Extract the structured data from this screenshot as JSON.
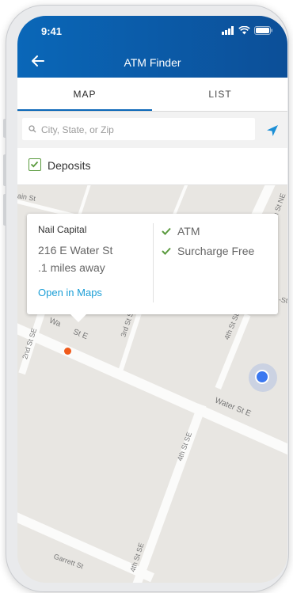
{
  "status": {
    "time": "9:41"
  },
  "header": {
    "title": "ATM Finder"
  },
  "tabs": [
    {
      "label": "MAP"
    },
    {
      "label": "LIST"
    }
  ],
  "search": {
    "placeholder": "City, State, or Zip"
  },
  "filter": {
    "label": "Deposits",
    "checked": true
  },
  "map": {
    "street_labels": [
      "ain St",
      "Wa",
      "St E",
      "2nd St SE",
      "3rd St SE",
      "4th St SE",
      "Water St E",
      "4th St SE",
      "Garrett St",
      "4th St SE",
      "h St NE",
      "-St"
    ]
  },
  "callout": {
    "name": "Nail Capital",
    "address": "216 E Water St",
    "distance": ".1 miles away",
    "link": "Open in Maps",
    "features": [
      "ATM",
      "Surcharge Free"
    ]
  },
  "colors": {
    "brand": "#0a67b8",
    "link": "#1b9ed6",
    "check": "#5a9a3e",
    "pin": "#f05a1a",
    "location": "#3b78f0"
  }
}
